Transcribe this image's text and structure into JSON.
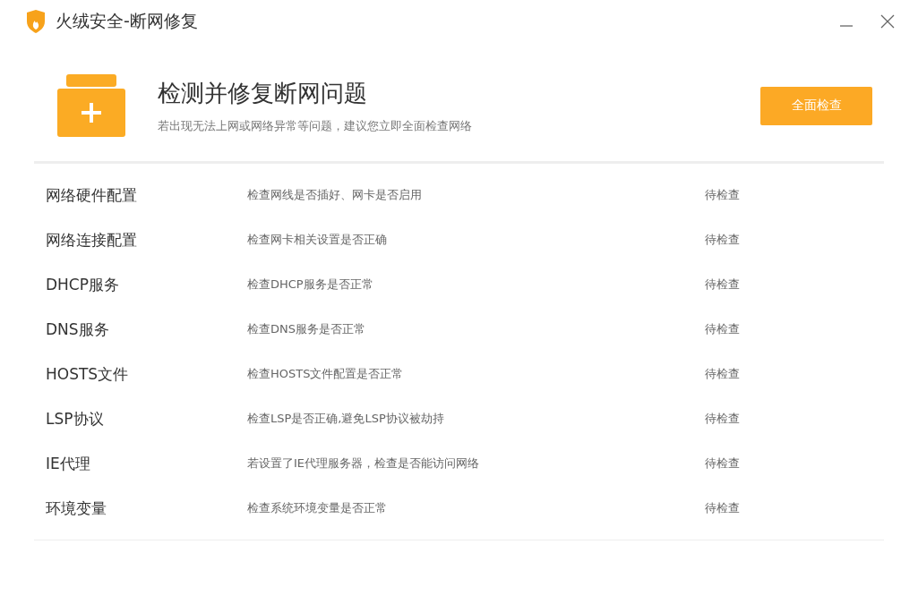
{
  "window": {
    "title": "火绒安全-断网修复"
  },
  "header": {
    "title": "检测并修复断网问题",
    "subtitle": "若出现无法上网或网络异常等问题，建议您立即全面检查网络",
    "button": "全面检查"
  },
  "checks": [
    {
      "name": "网络硬件配置",
      "description": "检查网线是否插好、网卡是否启用",
      "status": "待检查"
    },
    {
      "name": "网络连接配置",
      "description": "检查网卡相关设置是否正确",
      "status": "待检查"
    },
    {
      "name": "DHCP服务",
      "description": "检查DHCP服务是否正常",
      "status": "待检查"
    },
    {
      "name": "DNS服务",
      "description": "检查DNS服务是否正常",
      "status": "待检查"
    },
    {
      "name": "HOSTS文件",
      "description": "检查HOSTS文件配置是否正常",
      "status": "待检查"
    },
    {
      "name": "LSP协议",
      "description": "检查LSP是否正确,避免LSP协议被劫持",
      "status": "待检查"
    },
    {
      "name": "IE代理",
      "description": "若设置了IE代理服务器，检查是否能访问网络",
      "status": "待检查"
    },
    {
      "name": "环境变量",
      "description": "检查系统环境变量是否正常",
      "status": "待检查"
    }
  ]
}
